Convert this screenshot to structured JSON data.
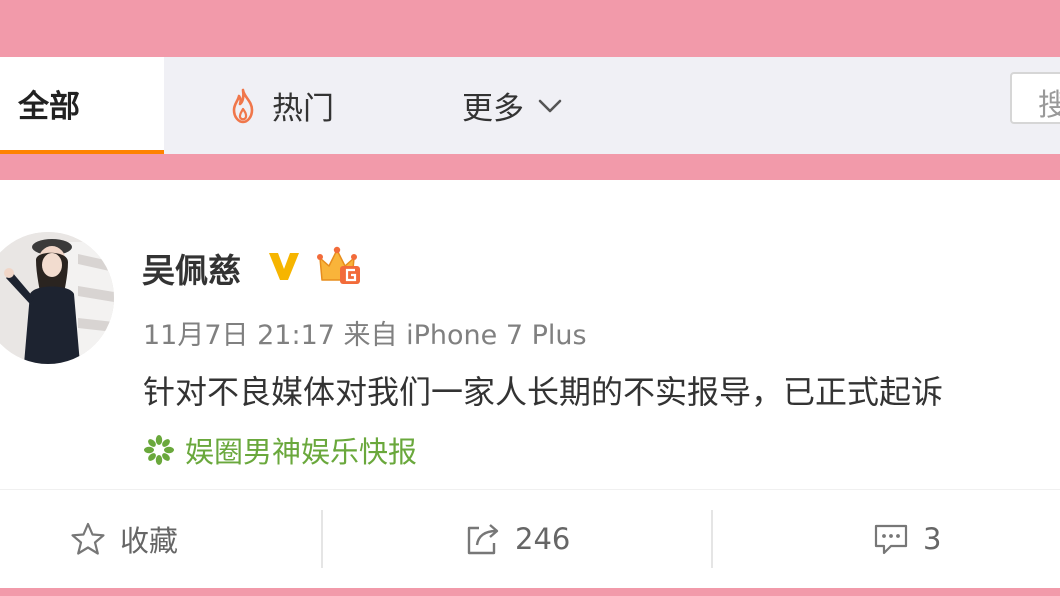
{
  "tabs": {
    "all": "全部",
    "hot": "热门",
    "more": "更多",
    "search_placeholder": "搜"
  },
  "post": {
    "username": "吴佩慈",
    "timestamp": "11月7日 21:17",
    "source": "来自 iPhone 7 Plus",
    "text": "针对不良媒体对我们一家人长期的不实报导，已正式起诉",
    "topic": "娱圈男神娱乐快报"
  },
  "actions": {
    "favorite_label": "收藏",
    "share_count": "246",
    "comment_count": "3"
  },
  "colors": {
    "frame_pink": "#f29aaa",
    "accent_orange": "#ff8200",
    "topic_green": "#6aa83c",
    "verified_gold": "#f6b500"
  },
  "icons": [
    "fire-icon",
    "chevron-down-icon",
    "verified-icon",
    "vip-crown-icon",
    "topic-icon",
    "star-icon",
    "share-icon",
    "comment-icon"
  ]
}
